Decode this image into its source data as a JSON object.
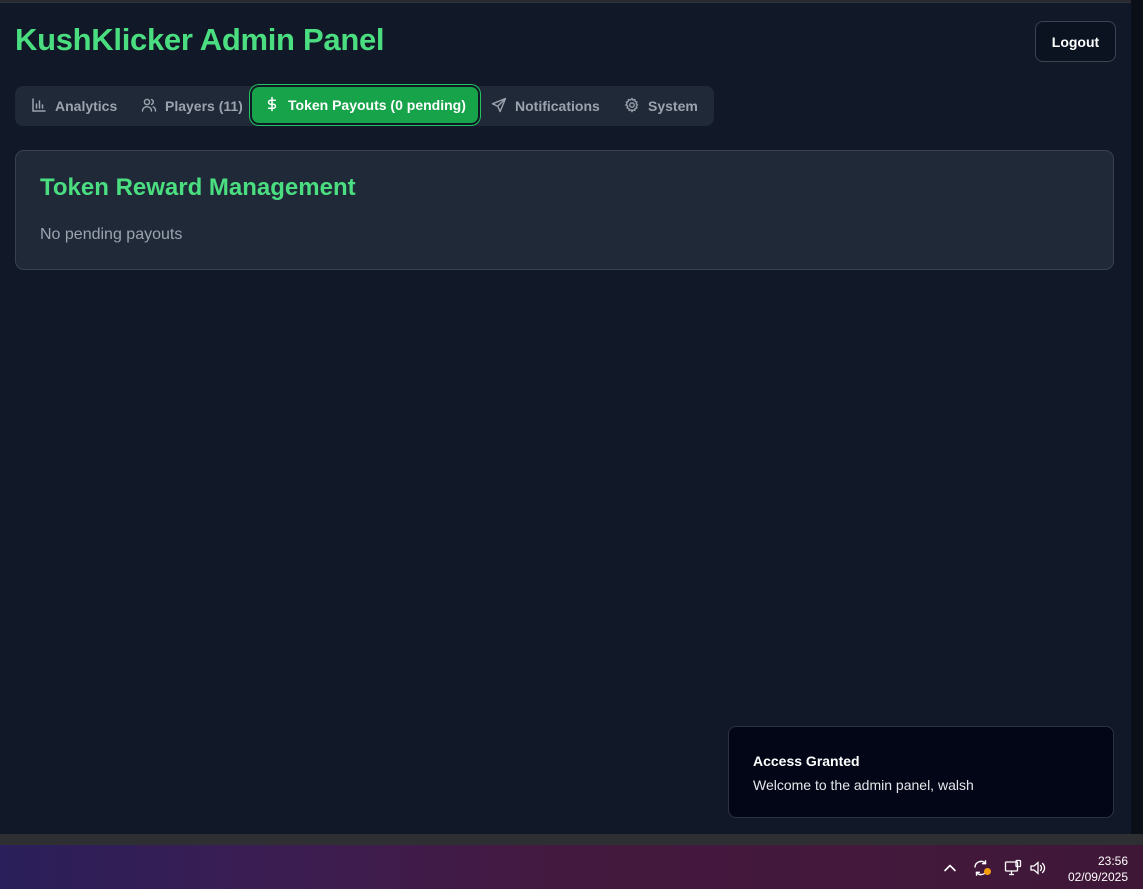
{
  "app": {
    "title": "KushKlicker Admin Panel",
    "logout_label": "Logout"
  },
  "tabs": [
    {
      "label": "Analytics",
      "icon": "bar-chart-icon",
      "active": false
    },
    {
      "label": "Players (11)",
      "icon": "users-icon",
      "active": false
    },
    {
      "label": "Token Payouts (0 pending)",
      "icon": "dollar-icon",
      "active": true
    },
    {
      "label": "Notifications",
      "icon": "send-icon",
      "active": false
    },
    {
      "label": "System",
      "icon": "gear-icon",
      "active": false
    }
  ],
  "panel": {
    "title": "Token Reward Management",
    "empty_text": "No pending payouts"
  },
  "toast": {
    "title": "Access Granted",
    "message": "Welcome to the admin panel, walsh"
  },
  "taskbar": {
    "time": "23:56",
    "date": "02/09/2025",
    "tray_icons": [
      "chevron-up-icon",
      "sync-icon",
      "network-icon",
      "volume-icon"
    ]
  },
  "colors": {
    "accent": "#4ade80",
    "active_tab": "#16a34a",
    "background": "#111827",
    "card": "#1f2937"
  }
}
